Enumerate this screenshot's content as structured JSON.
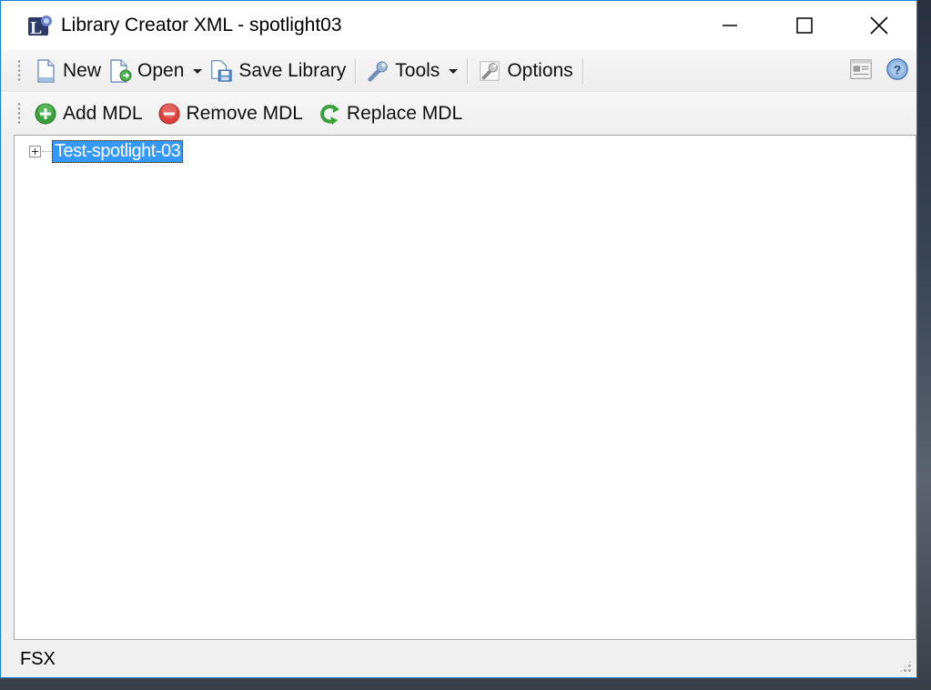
{
  "window": {
    "title": "Library Creator XML - spotlight03"
  },
  "toolbar_main": {
    "new_label": "New",
    "open_label": "Open",
    "save_label": "Save Library",
    "tools_label": "Tools",
    "options_label": "Options"
  },
  "toolbar_mdl": {
    "add_label": "Add MDL",
    "remove_label": "Remove MDL",
    "replace_label": "Replace MDL"
  },
  "tree": {
    "root_label": "Test-spotlight-03"
  },
  "status": {
    "text": "FSX"
  },
  "icons": {
    "app": "library-creator-icon",
    "new": "new-document-icon",
    "open": "open-document-icon",
    "save": "save-library-icon",
    "tools": "wrench-icon",
    "options": "options-wrench-icon",
    "view": "view-details-icon",
    "help": "help-icon",
    "add": "add-circle-icon",
    "remove": "remove-circle-icon",
    "replace": "replace-arrow-icon"
  },
  "colors": {
    "selection": "#3399ff",
    "window_border": "#1c7fd6",
    "add_green": "#3aa13a",
    "remove_red": "#d9413a"
  }
}
